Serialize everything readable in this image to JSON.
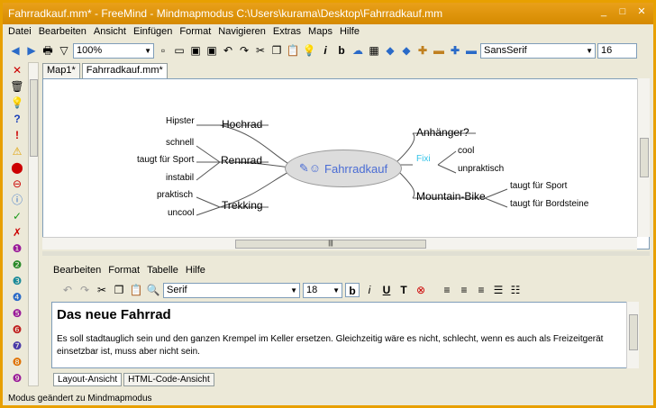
{
  "window": {
    "title": "Fahrradkauf.mm* - FreeMind - Mindmapmodus C:\\Users\\kurama\\Desktop\\Fahrradkauf.mm"
  },
  "menu": [
    "Datei",
    "Bearbeiten",
    "Ansicht",
    "Einfügen",
    "Format",
    "Navigieren",
    "Extras",
    "Maps",
    "Hilfe"
  ],
  "toolbar": {
    "zoom": "100%",
    "font": "SansSerif",
    "font_size": "16"
  },
  "tabs": [
    {
      "label": "Map1*"
    },
    {
      "label": "Fahrradkauf.mm*"
    }
  ],
  "map": {
    "center": "Fahrradkauf",
    "left": [
      {
        "label": "Hochrad",
        "children": [
          "Hipster"
        ]
      },
      {
        "label": "Rennrad",
        "children": [
          "schnell",
          "taugt für Sport",
          "instabil"
        ]
      },
      {
        "label": "Trekking",
        "children": [
          "praktisch",
          "uncool"
        ]
      }
    ],
    "right": [
      {
        "label": "Anhänger?",
        "children": []
      },
      {
        "label": "Fixi",
        "children": [
          "cool",
          "unpraktisch"
        ]
      },
      {
        "label": "Mountain-Bike",
        "children": [
          "taugt für Sport",
          "taugt für Bordsteine"
        ]
      }
    ]
  },
  "editor": {
    "menu": [
      "Bearbeiten",
      "Format",
      "Tabelle",
      "Hilfe"
    ],
    "font": "Serif",
    "font_size": "18",
    "heading": "Das neue Fahrrad",
    "body": "Es soll stadtauglich sein und den ganzen Krempel im Keller ersetzen. Gleichzeitig wäre es nicht, schlecht, wenn es auch als Freizeitgerät einsetzbar ist, muss aber nicht sein.",
    "view_tabs": [
      "Layout-Ansicht",
      "HTML-Code-Ansicht"
    ]
  },
  "status": "Modus geändert zu Mindmapmodus",
  "colors": {
    "titlebar": "#e9a01a",
    "link": "#555555",
    "fixi": "#33c3e8",
    "center_text": "#4a6cd4"
  }
}
